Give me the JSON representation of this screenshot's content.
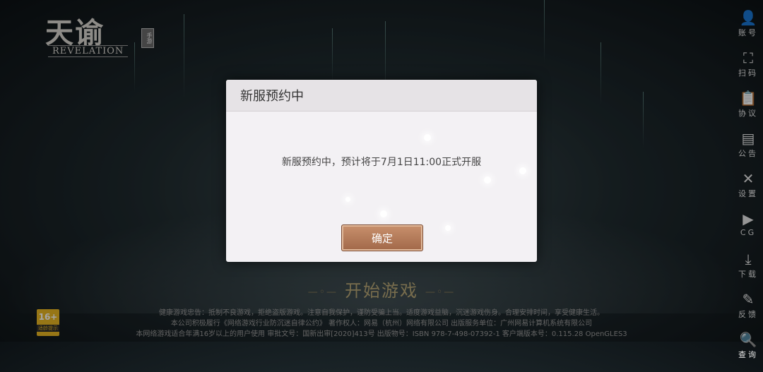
{
  "logo": {
    "title": "天谕",
    "badge": "手游",
    "subtitle": "REVELATION"
  },
  "sidebar": {
    "items": [
      {
        "label": "账号",
        "icon": "account-icon"
      },
      {
        "label": "扫码",
        "icon": "scan-icon"
      },
      {
        "label": "协议",
        "icon": "agreement-icon"
      },
      {
        "label": "公告",
        "icon": "notice-icon"
      },
      {
        "label": "设置",
        "icon": "settings-icon"
      },
      {
        "label": "CG",
        "icon": "video-icon"
      },
      {
        "label": "下载",
        "icon": "download-icon"
      },
      {
        "label": "反馈",
        "icon": "feedback-icon"
      },
      {
        "label": "查询",
        "icon": "query-icon"
      }
    ]
  },
  "start_game": "开始游戏",
  "footer": {
    "line1": "健康游戏忠告：抵制不良游戏，拒绝盗版游戏。注意自我保护，谨防受骗上当。适度游戏益脑，沉迷游戏伤身。合理安排时间，享受健康生活。",
    "line2": "本公司积极履行《网络游戏行业防沉迷自律公约》  著作权人：网易（杭州）网络有限公司 出版服务单位：广州网易计算机系统有限公司",
    "line3": "本网络游戏适合年满16岁以上的用户使用  审批文号：国新出审[2020]413号 出版物号：ISBN 978-7-498-07392-1  客户端版本号：0.115.28 OpenGLES3"
  },
  "age_rating": {
    "value": "16+",
    "label": "适龄提示"
  },
  "dialog": {
    "title": "新服预约中",
    "message": "新服预约中，预计将于7月1日11:00正式开服",
    "confirm_label": "确定"
  }
}
